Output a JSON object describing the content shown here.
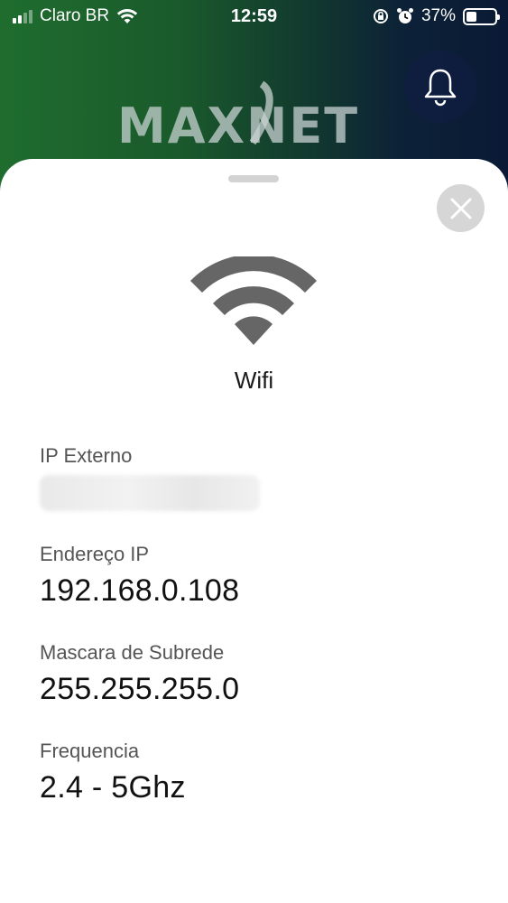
{
  "status_bar": {
    "carrier": "Claro BR",
    "time": "12:59",
    "battery_percent": "37%",
    "battery_level": 0.37,
    "signal_bars": 2
  },
  "header": {
    "logo_text": "MAXNET",
    "bell_icon": "bell-icon"
  },
  "sheet": {
    "close_icon": "close-icon",
    "wifi_icon": "wifi-icon",
    "title": "Wifi",
    "fields": [
      {
        "label": "IP Externo",
        "value": ""
      },
      {
        "label": "Endereço IP",
        "value": "192.168.0.108"
      },
      {
        "label": "Mascara de Subrede",
        "value": "255.255.255.0"
      },
      {
        "label": "Frequencia",
        "value": "2.4 - 5Ghz"
      }
    ]
  },
  "colors": {
    "header_green": "#1f6d2e",
    "header_navy": "#0a1a36",
    "icon_gray": "#666666",
    "close_bg": "#d6d6d6"
  }
}
